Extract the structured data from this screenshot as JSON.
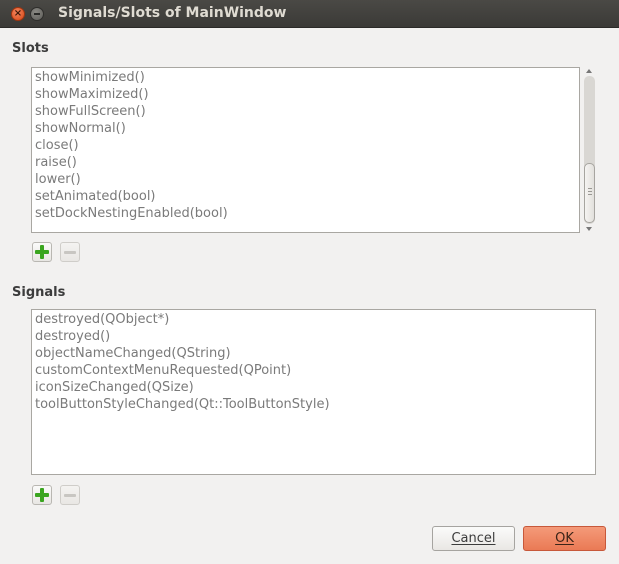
{
  "window": {
    "title": "Signals/Slots of MainWindow",
    "close_glyph": "×",
    "minimize_glyph": "–"
  },
  "slots": {
    "label": "Slots",
    "items": [
      "showMinimized()",
      "showMaximized()",
      "showFullScreen()",
      "showNormal()",
      "close()",
      "raise()",
      "lower()",
      "setAnimated(bool)",
      "setDockNestingEnabled(bool)"
    ]
  },
  "signals": {
    "label": "Signals",
    "items": [
      "destroyed(QObject*)",
      "destroyed()",
      "objectNameChanged(QString)",
      "customContextMenuRequested(QPoint)",
      "iconSizeChanged(QSize)",
      "toolButtonStyleChanged(Qt::ToolButtonStyle)"
    ]
  },
  "buttons": {
    "cancel": "Cancel",
    "ok": "OK"
  },
  "colors": {
    "accent_ok": "#ea7a55",
    "add_icon": "#3aa51f",
    "titlebar": "#3c3b37"
  },
  "icons": {
    "add": "plus-icon",
    "remove": "minus-icon"
  }
}
